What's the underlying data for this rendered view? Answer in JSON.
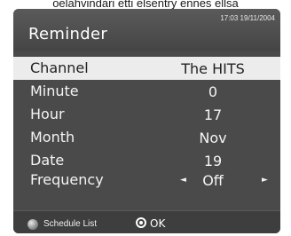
{
  "header_fragment": "oelahvindari etti elsentry ennes ellsa",
  "dialog": {
    "title": "Reminder",
    "datetime": "17:03 19/11/2004"
  },
  "fields": [
    {
      "label": "Channel",
      "value": "The HITS"
    },
    {
      "label": "Minute",
      "value": "0"
    },
    {
      "label": "Hour",
      "value": "17"
    },
    {
      "label": "Month",
      "value": "Nov"
    },
    {
      "label": "Date",
      "value": "19"
    },
    {
      "label": "Frequency",
      "value": "Off",
      "left_arrow": "◄",
      "right_arrow": "►"
    }
  ],
  "footer": {
    "schedule_list_label": "Schedule List",
    "ok_label": "OK"
  },
  "colors": {
    "panel": "#4a4a4a",
    "highlight_row": "#ececec",
    "text": "#f4f4f4"
  }
}
